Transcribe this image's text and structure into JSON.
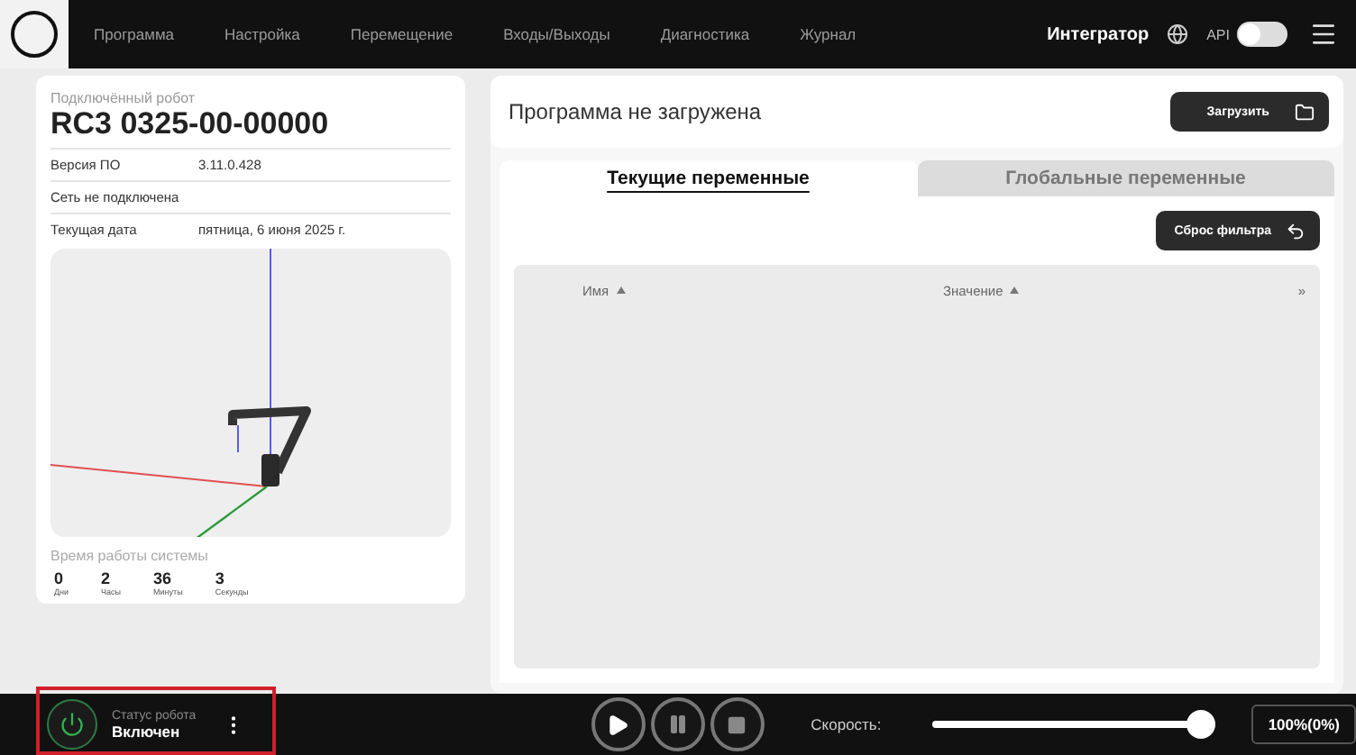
{
  "nav": {
    "items": [
      {
        "label": "Программа",
        "selected": false
      },
      {
        "label": "Настройка",
        "selected": false
      },
      {
        "label": "Перемещение",
        "selected": false
      },
      {
        "label": "Входы/Выходы",
        "selected": false
      },
      {
        "label": "Диагностика",
        "selected": false
      },
      {
        "label": "Журнал",
        "selected": false
      }
    ],
    "user": "Интегратор",
    "api": {
      "label": "API",
      "on": false
    }
  },
  "robot": {
    "caption": "Подключённый робот",
    "name": "RC3 0325-00-00000",
    "info": [
      {
        "label": "Версия ПО",
        "value": "3.11.0.428"
      },
      {
        "label": "Сеть не подключена"
      },
      {
        "label": "Текущая дата",
        "value": "пятница, 6 июня 2025 г."
      }
    ],
    "uptime": {
      "title": "Время работы системы",
      "parts": [
        {
          "value": "0",
          "unit": "Дни"
        },
        {
          "value": "2",
          "unit": "Часы"
        },
        {
          "value": "36",
          "unit": "Минуты"
        },
        {
          "value": "3",
          "unit": "Секунды"
        }
      ]
    }
  },
  "program": {
    "status": "Программа не загружена",
    "load_button": "Загрузить"
  },
  "tabs": [
    {
      "label": "Текущие переменные",
      "selected": true
    },
    {
      "label": "Глобальные переменные",
      "selected": false
    }
  ],
  "reset_filter": "Сброс фильтра",
  "table": {
    "columns": [
      "Имя",
      "Значение"
    ],
    "expand": "»"
  },
  "status_bar": {
    "robot_status": {
      "caption": "Статус робота",
      "value": "Включен",
      "highlighted": true
    },
    "speed": {
      "label": "Скорость:",
      "level": 1,
      "reading": "100%(0%)"
    }
  }
}
